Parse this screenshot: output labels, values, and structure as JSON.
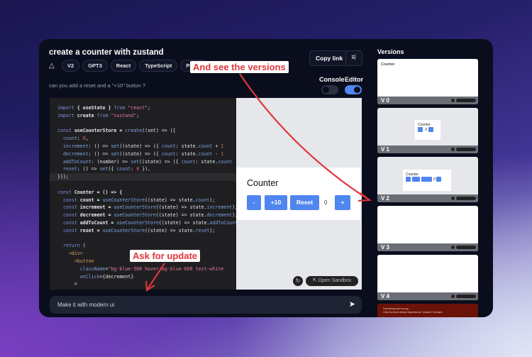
{
  "header": {
    "title": "create a counter with zustand",
    "tags": [
      "V2",
      "GPT3",
      "React",
      "TypeScript",
      "Public"
    ],
    "copy_link": "Copy link",
    "settings_icon": "sliders-icon"
  },
  "prompt": "can you add a reset and a \"+10\" button ?",
  "toggles": {
    "console": {
      "label": "Console",
      "on": false
    },
    "editor": {
      "label": "Editor",
      "on": true
    },
    "accent": "#4f86f0"
  },
  "code": [
    [
      [
        "import",
        "kw"
      ],
      [
        " { useState } ",
        "pl"
      ],
      [
        "from",
        "kw"
      ],
      [
        " \"react\"",
        "str"
      ],
      [
        ";",
        ""
      ]
    ],
    [
      [
        "import",
        "kw"
      ],
      [
        " create ",
        "pl"
      ],
      [
        "from",
        "kw"
      ],
      [
        " \"zustand\"",
        "str"
      ],
      [
        ";",
        ""
      ]
    ],
    [],
    [
      [
        "const",
        "kw"
      ],
      [
        " useCounterStore = ",
        "pl"
      ],
      [
        "create",
        "fn"
      ],
      [
        "((set) => ({",
        ""
      ]
    ],
    [
      [
        "  count",
        "prop"
      ],
      [
        ": ",
        ""
      ],
      [
        "0",
        "num"
      ],
      [
        ",",
        ""
      ]
    ],
    [
      [
        "  increment",
        "prop"
      ],
      [
        ": () => ",
        ""
      ],
      [
        "set",
        "fn"
      ],
      [
        "((state) => ({ ",
        ""
      ],
      [
        "count",
        "prop"
      ],
      [
        ": state.",
        ""
      ],
      [
        "count",
        "prop"
      ],
      [
        " + ",
        ""
      ],
      [
        "1",
        "num"
      ]
    ],
    [
      [
        "  decrement",
        "prop"
      ],
      [
        ": () => ",
        ""
      ],
      [
        "set",
        "fn"
      ],
      [
        "((state) => ({ ",
        ""
      ],
      [
        "count",
        "prop"
      ],
      [
        ": state.",
        ""
      ],
      [
        "count",
        "prop"
      ],
      [
        " - ",
        ""
      ],
      [
        "1",
        "num"
      ]
    ],
    [
      [
        "  addToCount",
        "prop"
      ],
      [
        ": (number) => ",
        ""
      ],
      [
        "set",
        "fn"
      ],
      [
        "((state) => ({ ",
        ""
      ],
      [
        "count",
        "prop"
      ],
      [
        ": state.",
        ""
      ],
      [
        "count",
        "prop"
      ]
    ],
    [
      [
        "  reset",
        "prop"
      ],
      [
        ": () => ",
        ""
      ],
      [
        "set",
        "fn"
      ],
      [
        "({ ",
        ""
      ],
      [
        "count",
        "prop"
      ],
      [
        ": ",
        ""
      ],
      [
        "0",
        "num"
      ],
      [
        " }),",
        ""
      ]
    ],
    [
      [
        "}));",
        ""
      ]
    ],
    [],
    [
      [
        "const",
        "kw"
      ],
      [
        " Counter = () => {",
        "pl"
      ]
    ],
    [
      [
        "  const",
        "kw"
      ],
      [
        " count = ",
        "pl"
      ],
      [
        "useCounterStore",
        "fn"
      ],
      [
        "((state) => state.",
        ""
      ],
      [
        "count",
        "prop"
      ],
      [
        ");",
        ""
      ]
    ],
    [
      [
        "  const",
        "kw"
      ],
      [
        " increment = ",
        "pl"
      ],
      [
        "useCounterStore",
        "fn"
      ],
      [
        "((state) => state.",
        ""
      ],
      [
        "increment",
        "prop"
      ],
      [
        ");",
        ""
      ]
    ],
    [
      [
        "  const",
        "kw"
      ],
      [
        " decrement = ",
        "pl"
      ],
      [
        "useCounterStore",
        "fn"
      ],
      [
        "((state) => state.",
        ""
      ],
      [
        "decrement",
        "prop"
      ],
      [
        ");",
        ""
      ]
    ],
    [
      [
        "  const",
        "kw"
      ],
      [
        " addToCount = ",
        "pl"
      ],
      [
        "useCounterStore",
        "fn"
      ],
      [
        "((state) => state.",
        ""
      ],
      [
        "addToCount",
        "prop"
      ],
      [
        ");",
        ""
      ]
    ],
    [
      [
        "  const",
        "kw"
      ],
      [
        " reset = ",
        "pl"
      ],
      [
        "useCounterStore",
        "fn"
      ],
      [
        "((state) => state.",
        ""
      ],
      [
        "reset",
        "prop"
      ],
      [
        ");",
        ""
      ]
    ],
    [],
    [
      [
        "  return",
        "kw"
      ],
      [
        " (",
        ""
      ]
    ],
    [
      [
        "    <div>",
        "tagc"
      ]
    ],
    [
      [
        "      <button",
        "tagc"
      ]
    ],
    [
      [
        "        className",
        "prop"
      ],
      [
        "=",
        ""
      ],
      [
        "\"bg-blue-500 hover:bg-blue-600 text-white",
        "str"
      ]
    ],
    [
      [
        "        onClick",
        "prop"
      ],
      [
        "={decrement}",
        ""
      ]
    ],
    [
      [
        "      >",
        ""
      ]
    ]
  ],
  "preview": {
    "title": "Counter",
    "buttons": [
      "-",
      "+10",
      "Reset",
      "+"
    ],
    "value": "0",
    "open_sandbox": "Open Sandbox",
    "refresh_icon": "refresh-icon"
  },
  "input": {
    "value": "Make it with modern ui",
    "send_icon": "send-icon"
  },
  "versions": {
    "title": "Versions",
    "items": [
      "V 0",
      "V 1",
      "V 2",
      "V 3",
      "V 4"
    ],
    "thumb_title": "Counter",
    "error_title": "Something went wrong",
    "error_text": "Only first-level default dependency \"zustand\" included"
  },
  "annotations": {
    "versions": "And see the versions",
    "update": "Ask for update",
    "color": "#e0353b"
  }
}
